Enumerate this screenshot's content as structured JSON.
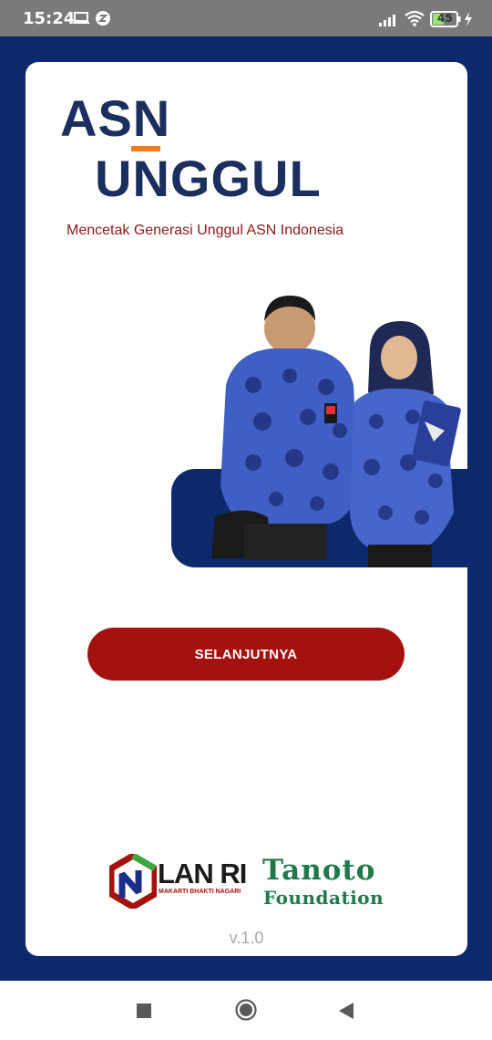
{
  "status_bar": {
    "time": "15:24",
    "battery_level": "45",
    "icons": [
      "laptop-icon",
      "z-app-icon",
      "signal-icon",
      "wifi-icon",
      "battery-icon",
      "charging-icon"
    ]
  },
  "brand": {
    "line1": "ASN",
    "line2": "UNGGUL",
    "tagline": "Mencetak Generasi Unggul ASN Indonesia"
  },
  "primary_button": {
    "label": "SELANJUTNYA"
  },
  "partners": {
    "lan_name": "LAN RI",
    "lan_motto": "MAKARTI BHAKTI NAGARI",
    "tanoto_line1": "Tanoto",
    "tanoto_line2": "Foundation"
  },
  "version": "v.1.0",
  "colors": {
    "background": "#0c2a6b",
    "button": "#a3120e",
    "tagline": "#8b1a1a",
    "logo": "#1b2f5e",
    "accent": "#f07d1a",
    "tanoto_green": "#1f7a4b"
  },
  "nav_bar": {
    "buttons": [
      "recents-button",
      "home-button",
      "back-button"
    ]
  }
}
